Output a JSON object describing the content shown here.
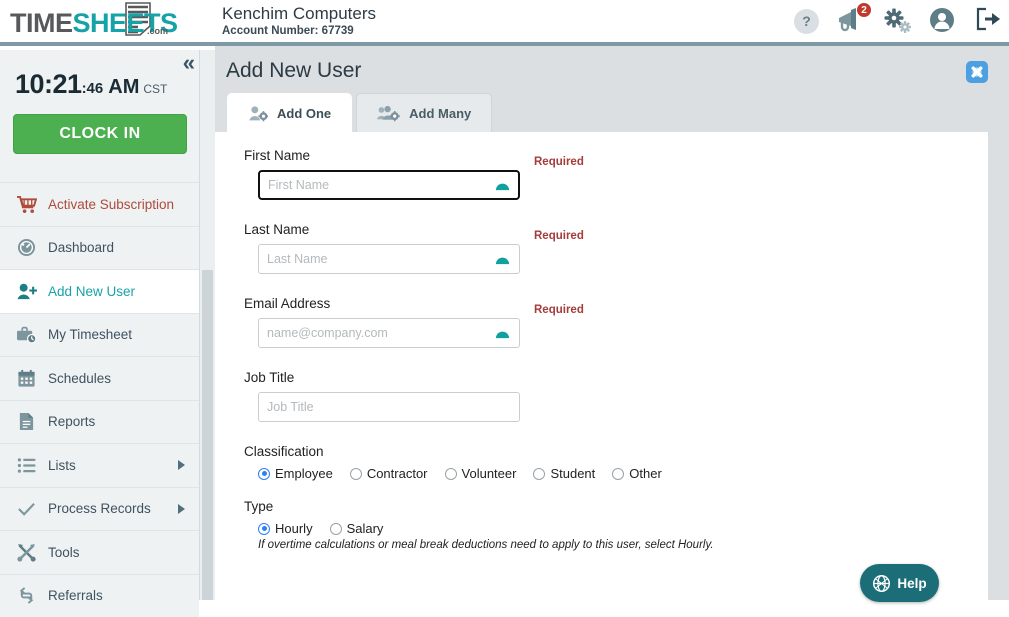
{
  "header": {
    "logo": {
      "part1": "TIME",
      "part2": "SHEETS",
      "suffix": ".com"
    },
    "company_name": "Kenchim Computers",
    "account_label": "Account Number: 67739",
    "icons": {
      "help": "?",
      "announcements_badge": "2"
    }
  },
  "sidebar": {
    "clock": {
      "hour_minute": "10:21",
      "seconds": ":46",
      "meridiem": "AM",
      "timezone": "CST"
    },
    "clock_in_label": "CLOCK IN",
    "items": [
      {
        "label": "Activate Subscription",
        "icon": "cart-icon",
        "state": "alert",
        "arrow": false
      },
      {
        "label": "Dashboard",
        "icon": "gauge-icon",
        "state": "normal",
        "arrow": false
      },
      {
        "label": "Add New User",
        "icon": "user-plus-icon",
        "state": "active",
        "arrow": false
      },
      {
        "label": "My Timesheet",
        "icon": "briefcase-clock-icon",
        "state": "normal",
        "arrow": false
      },
      {
        "label": "Schedules",
        "icon": "calendar-icon",
        "state": "normal",
        "arrow": false
      },
      {
        "label": "Reports",
        "icon": "document-icon",
        "state": "normal",
        "arrow": false
      },
      {
        "label": "Lists",
        "icon": "list-icon",
        "state": "normal",
        "arrow": true
      },
      {
        "label": "Process Records",
        "icon": "check-icon",
        "state": "normal",
        "arrow": true
      },
      {
        "label": "Tools",
        "icon": "tools-icon",
        "state": "normal",
        "arrow": false
      },
      {
        "label": "Referrals",
        "icon": "referral-icon",
        "state": "normal",
        "arrow": false
      }
    ]
  },
  "main": {
    "page_title": "Add New User",
    "tabs": [
      {
        "label": "Add One",
        "active": true
      },
      {
        "label": "Add Many",
        "active": false
      }
    ],
    "fields": {
      "first_name": {
        "label": "First Name",
        "placeholder": "First Name",
        "value": "",
        "required_text": "Required"
      },
      "last_name": {
        "label": "Last Name",
        "placeholder": "Last Name",
        "value": "",
        "required_text": "Required"
      },
      "email": {
        "label": "Email Address",
        "placeholder": "name@company.com",
        "value": "",
        "required_text": "Required"
      },
      "job_title": {
        "label": "Job Title",
        "placeholder": "Job Title",
        "value": ""
      }
    },
    "classification": {
      "label": "Classification",
      "options": [
        {
          "label": "Employee",
          "selected": true
        },
        {
          "label": "Contractor",
          "selected": false
        },
        {
          "label": "Volunteer",
          "selected": false
        },
        {
          "label": "Student",
          "selected": false
        },
        {
          "label": "Other",
          "selected": false
        }
      ]
    },
    "type": {
      "label": "Type",
      "options": [
        {
          "label": "Hourly",
          "selected": true
        },
        {
          "label": "Salary",
          "selected": false
        }
      ],
      "hint": "If overtime calculations or meal break deductions need to apply to this user, select Hourly."
    },
    "help_button_label": "Help"
  },
  "colors": {
    "brand_teal": "#15a3a8",
    "clock_in_green": "#4caf50",
    "required_red": "#a53c3c",
    "badge_red": "#c0392b",
    "help_teal": "#1b6e78",
    "radio_blue": "#2d7ff9"
  }
}
